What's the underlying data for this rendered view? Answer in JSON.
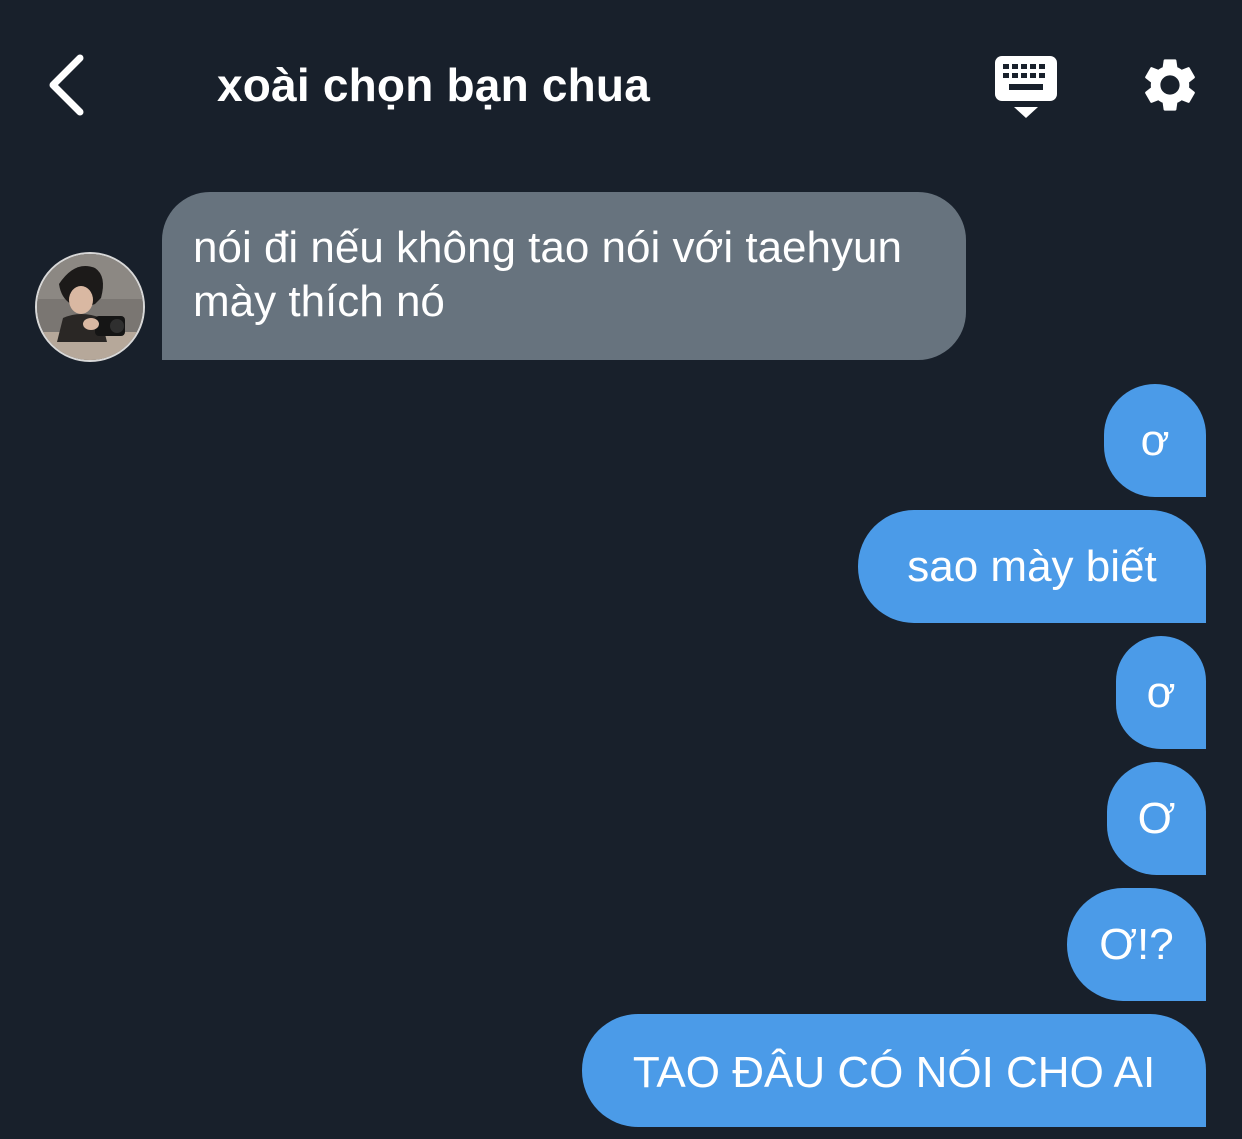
{
  "header": {
    "title": "xoài chọn bạn chua",
    "back_icon": "chevron-left-icon",
    "keyboard_icon": "keyboard-icon",
    "settings_icon": "gear-icon"
  },
  "colors": {
    "background": "#18202b",
    "received_bubble": "#67737e",
    "sent_bubble": "#4b9be8",
    "text": "#ffffff"
  },
  "messages": [
    {
      "direction": "received",
      "text": "nói đi nếu không tao nói với taehyun mày thích nó"
    },
    {
      "direction": "sent",
      "text": "ơ"
    },
    {
      "direction": "sent",
      "text": "sao mày biết"
    },
    {
      "direction": "sent",
      "text": "ơ"
    },
    {
      "direction": "sent",
      "text": "Ơ"
    },
    {
      "direction": "sent",
      "text": "Ơ!?"
    },
    {
      "direction": "sent",
      "text": "TAO ĐÂU CÓ NÓI CHO AI"
    }
  ]
}
